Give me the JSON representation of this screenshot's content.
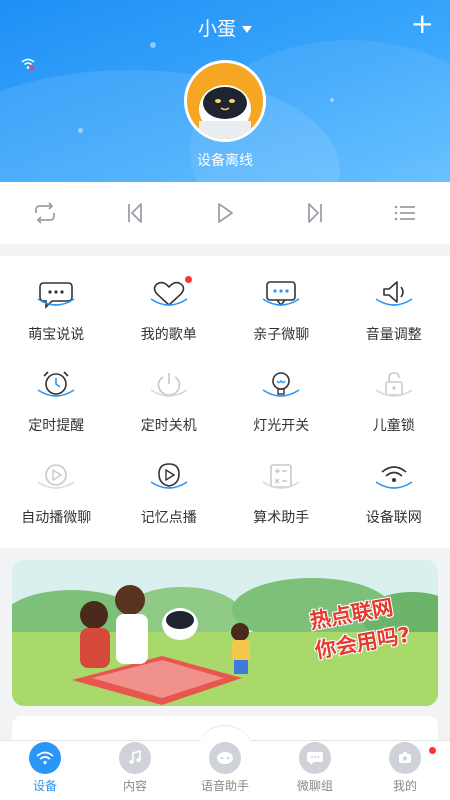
{
  "header": {
    "device_name": "小蛋",
    "status": "设备离线",
    "plus_label": "+"
  },
  "controls": [
    {
      "name": "loop-icon"
    },
    {
      "name": "previous-icon"
    },
    {
      "name": "play-icon"
    },
    {
      "name": "next-icon"
    },
    {
      "name": "playlist-icon"
    }
  ],
  "features": [
    {
      "label": "萌宝说说",
      "icon": "chat-icon",
      "badge": false
    },
    {
      "label": "我的歌单",
      "icon": "song-list-icon",
      "badge": true
    },
    {
      "label": "亲子微聊",
      "icon": "message-icon",
      "badge": false
    },
    {
      "label": "音量调整",
      "icon": "volume-icon",
      "badge": false
    },
    {
      "label": "定时提醒",
      "icon": "alarm-icon",
      "badge": false
    },
    {
      "label": "定时关机",
      "icon": "power-timer-icon",
      "badge": false
    },
    {
      "label": "灯光开关",
      "icon": "light-bulb-icon",
      "badge": false
    },
    {
      "label": "儿童锁",
      "icon": "lock-icon",
      "badge": false
    },
    {
      "label": "自动播微聊",
      "icon": "auto-play-icon",
      "badge": false
    },
    {
      "label": "记忆点播",
      "icon": "memory-play-icon",
      "badge": false
    },
    {
      "label": "算术助手",
      "icon": "math-icon",
      "badge": false
    },
    {
      "label": "设备联网",
      "icon": "wifi-icon",
      "badge": false
    }
  ],
  "banner": {
    "line1": "热点联网",
    "line2": "你会用吗?"
  },
  "tabs": [
    {
      "label": "设备",
      "icon": "device-icon",
      "active": true,
      "badge": false
    },
    {
      "label": "内容",
      "icon": "music-icon",
      "active": false,
      "badge": false
    },
    {
      "label": "语音助手",
      "icon": "robot-icon",
      "active": false,
      "badge": false
    },
    {
      "label": "微聊组",
      "icon": "chat-group-icon",
      "active": false,
      "badge": false
    },
    {
      "label": "我的",
      "icon": "profile-icon",
      "active": false,
      "badge": true
    }
  ],
  "colors": {
    "accent": "#2a96f5",
    "badge": "#ff3333",
    "banner_text": "#e63a2e"
  }
}
